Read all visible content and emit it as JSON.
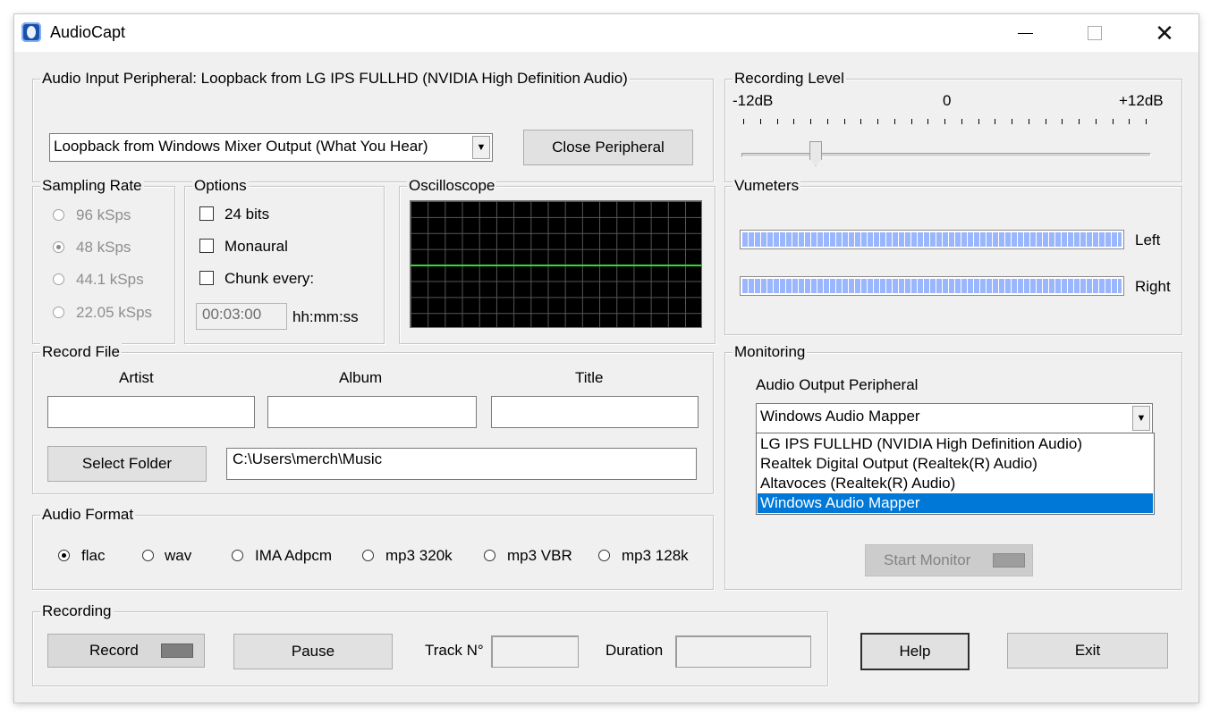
{
  "window": {
    "title": "AudioCapt",
    "icon": "app-logo-icon"
  },
  "input_peripheral": {
    "legend": "Audio Input Peripheral: Loopback from LG IPS FULLHD (NVIDIA High Definition Audio)",
    "selected": "Loopback from Windows Mixer Output (What You Hear)",
    "close_label": "Close Peripheral"
  },
  "recording_level": {
    "legend": "Recording Level",
    "min_label": "-12dB",
    "mid_label": "0",
    "max_label": "+12dB",
    "value_fraction": 0.18
  },
  "sampling_rate": {
    "legend": "Sampling Rate",
    "options": [
      "96 kSps",
      "48 kSps",
      "44.1 kSps",
      "22.05 kSps"
    ],
    "selected": "48 kSps"
  },
  "options": {
    "legend": "Options",
    "bits24": "24 bits",
    "monaural": "Monaural",
    "chunk": "Chunk every:",
    "chunk_value": "00:03:00",
    "chunk_unit": "hh:mm:ss"
  },
  "oscilloscope": {
    "legend": "Oscilloscope"
  },
  "vumeters": {
    "legend": "Vumeters",
    "left_label": "Left",
    "right_label": "Right"
  },
  "record_file": {
    "legend": "Record File",
    "artist_label": "Artist",
    "album_label": "Album",
    "title_label": "Title",
    "artist_value": "",
    "album_value": "",
    "title_value": "",
    "select_folder_label": "Select Folder",
    "folder_path": "C:\\Users\\merch\\Music"
  },
  "audio_format": {
    "legend": "Audio Format",
    "options": [
      "flac",
      "wav",
      "IMA Adpcm",
      "mp3 320k",
      "mp3 VBR",
      "mp3 128k"
    ],
    "selected": "flac"
  },
  "monitoring": {
    "legend": "Monitoring",
    "output_label": "Audio Output Peripheral",
    "selected": "Windows Audio Mapper",
    "dropdown_items": [
      "LG IPS FULLHD (NVIDIA High Definition Audio)",
      "Realtek Digital Output (Realtek(R) Audio)",
      "Altavoces (Realtek(R) Audio)",
      "Windows Audio Mapper"
    ],
    "start_label": "Start Monitor"
  },
  "recording": {
    "legend": "Recording",
    "record_label": "Record",
    "pause_label": "Pause",
    "track_label": "Track N°",
    "track_value": "",
    "duration_label": "Duration",
    "duration_value": ""
  },
  "footer": {
    "help_label": "Help",
    "exit_label": "Exit"
  },
  "colors": {
    "selection": "#0078d7",
    "scope_trace": "#2fdc2f",
    "vu_fill": "#9ab6ff"
  }
}
